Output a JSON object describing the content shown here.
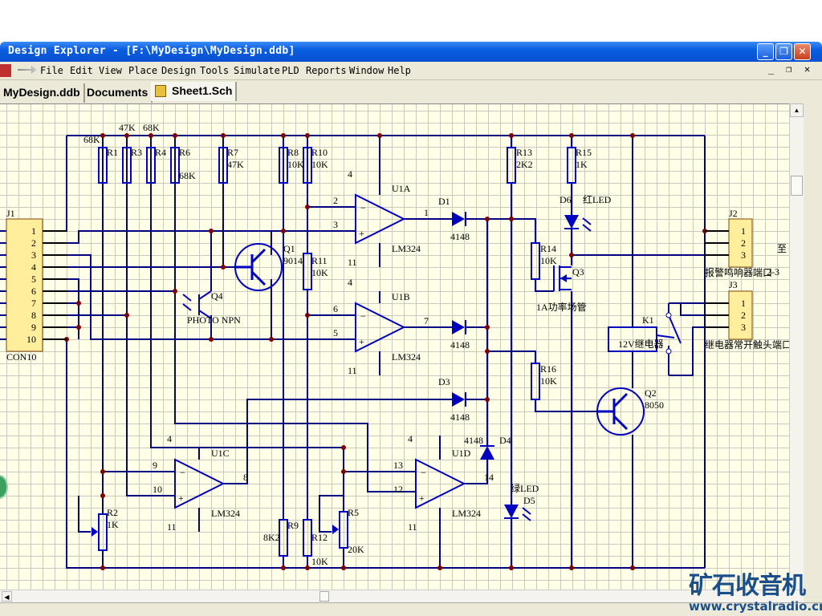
{
  "window": {
    "title": "Design Explorer - [F:\\MyDesign\\MyDesign.ddb]",
    "controls": [
      "minimize",
      "restore",
      "close"
    ]
  },
  "menu": [
    "File",
    "Edit",
    "View",
    "Place",
    "Design",
    "Tools",
    "Simulate",
    "PLD",
    "Reports",
    "Window",
    "Help"
  ],
  "tabs": [
    {
      "label": "MyDesign.ddb"
    },
    {
      "label": "Documents"
    },
    {
      "label": "Sheet1.Sch",
      "active": true
    }
  ],
  "colors": {
    "wire": "#000080",
    "part": "#0000c0",
    "junction": "#800000",
    "part_fill": "#ffef9c",
    "sheet": "#ffffe8"
  },
  "schematic": {
    "resistors": [
      {
        "ref": "R1",
        "value": "68K"
      },
      {
        "ref": "R3",
        "value": "47K"
      },
      {
        "ref": "R4",
        "value": "68K"
      },
      {
        "ref": "R6",
        "value": "68K"
      },
      {
        "ref": "R7",
        "value": "47K"
      },
      {
        "ref": "R8",
        "value": "10K"
      },
      {
        "ref": "R10",
        "value": "10K"
      },
      {
        "ref": "R11",
        "value": "10K"
      },
      {
        "ref": "R13",
        "value": "2K2"
      },
      {
        "ref": "R15",
        "value": "1K"
      },
      {
        "ref": "R14",
        "value": "10K"
      },
      {
        "ref": "R16",
        "value": "10K"
      },
      {
        "ref": "R9",
        "value": "8K2"
      },
      {
        "ref": "R12",
        "value": "10K"
      },
      {
        "ref": "R2",
        "value": "1K"
      },
      {
        "ref": "R5",
        "value": "20K"
      }
    ],
    "opamps": [
      {
        "ref": "U1A",
        "value": "LM324",
        "pins": [
          "2",
          "3",
          "1",
          "4",
          "11"
        ]
      },
      {
        "ref": "U1B",
        "value": "LM324",
        "pins": [
          "6",
          "5",
          "7",
          "4",
          "11"
        ]
      },
      {
        "ref": "U1C",
        "value": "LM324",
        "pins": [
          "9",
          "10",
          "8",
          "4",
          "11"
        ]
      },
      {
        "ref": "U1D",
        "value": "LM324",
        "pins": [
          "13",
          "12",
          "14",
          "4",
          "11"
        ]
      }
    ],
    "diodes": [
      {
        "ref": "D1",
        "value": "4148"
      },
      {
        "ref": "",
        "value": "4148"
      },
      {
        "ref": "D3",
        "value": "4148"
      },
      {
        "ref": "D4",
        "value": "4148"
      },
      {
        "ref": "D5",
        "value": "绿LED"
      },
      {
        "ref": "D6",
        "value": "红LED"
      }
    ],
    "transistors": [
      {
        "ref": "Q1",
        "value": "9014"
      },
      {
        "ref": "Q2",
        "value": "8050"
      },
      {
        "ref": "Q3",
        "value": "1A功率场管"
      },
      {
        "ref": "Q4",
        "value": "PHOTO NPN"
      }
    ],
    "relay": {
      "ref": "K1",
      "value": "12V继电器"
    },
    "connectors": [
      {
        "ref": "J1",
        "value": "CON10",
        "pins": [
          "1",
          "2",
          "3",
          "4",
          "5",
          "6",
          "7",
          "8",
          "9",
          "10"
        ]
      },
      {
        "ref": "J2",
        "value": "报警鸣响器端口",
        "pins": [
          "1",
          "2",
          "3"
        ]
      },
      {
        "ref": "J3",
        "value": "继电器常开触头端口",
        "pins": [
          "1",
          "2",
          "3"
        ]
      }
    ],
    "extra_text": [
      "至",
      "2-3"
    ]
  },
  "watermark": {
    "cn": "矿石收音机",
    "url": "www.crystalradio.cn"
  }
}
